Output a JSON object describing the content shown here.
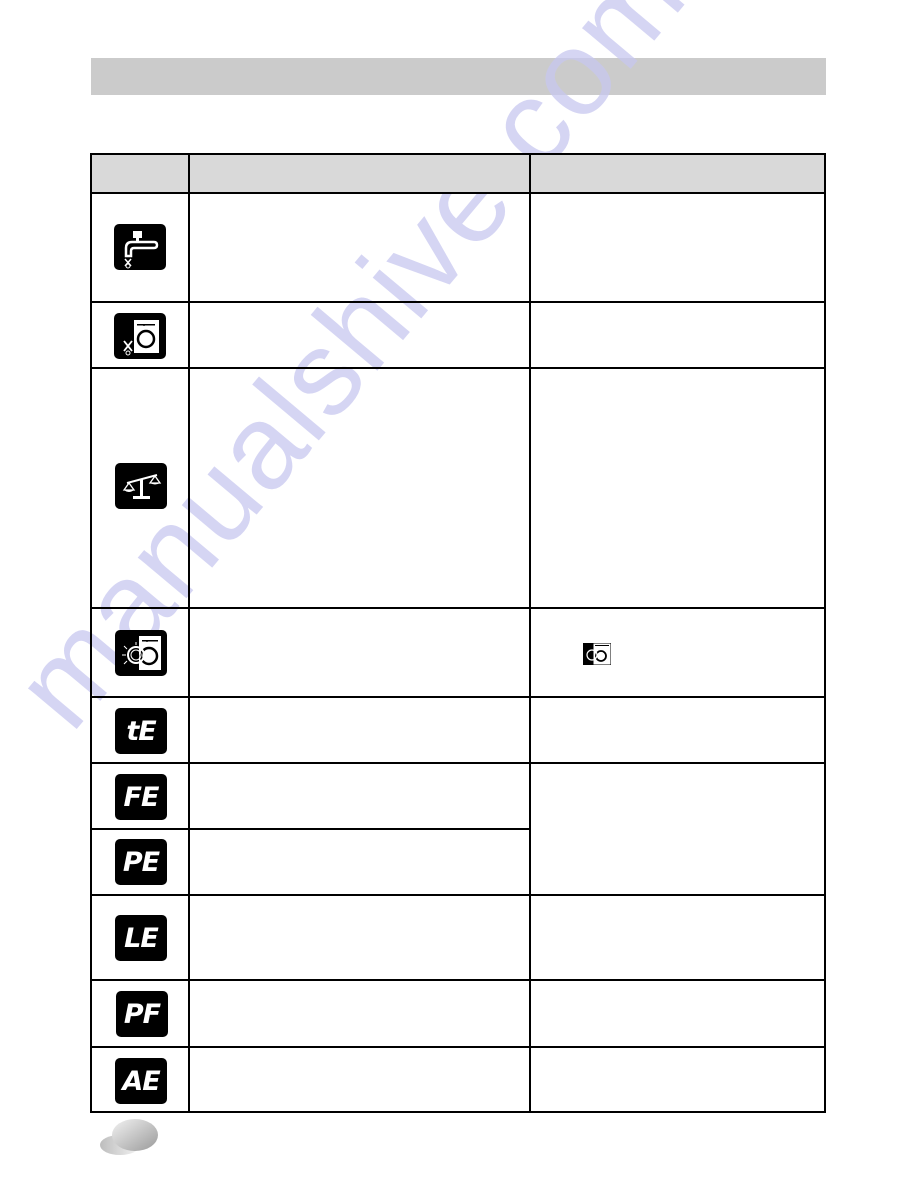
{
  "page": {
    "title_bar_text": "",
    "watermark": "manualshive.com",
    "colors": {
      "title_bar": "#cbcbcb",
      "table_header": "#d9d9d9",
      "border": "#000000",
      "icon_bg": "#000000",
      "icon_fg": "#ffffff",
      "watermark": "#c8c8f0"
    }
  },
  "table": {
    "headers": [
      "",
      "",
      ""
    ],
    "rows": [
      {
        "icon": "water-tap-error-icon",
        "code": "",
        "cause": "",
        "solution": ""
      },
      {
        "icon": "door-open-error-icon",
        "code": "",
        "cause": "",
        "solution": ""
      },
      {
        "icon": "unbalance-scale-icon",
        "code": "",
        "cause": "",
        "solution": ""
      },
      {
        "icon": "door-lock-washer-icon",
        "code": "",
        "cause": "",
        "solution": "",
        "solution_icon": "door-lock-washer-small-icon"
      },
      {
        "icon": "error-code-icon",
        "code": "tE",
        "cause": "",
        "solution": ""
      },
      {
        "icon": "error-code-icon",
        "code": "FE",
        "cause": "",
        "solution": ""
      },
      {
        "icon": "error-code-icon",
        "code": "PE",
        "cause": ""
      },
      {
        "icon": "error-code-icon",
        "code": "LE",
        "cause": "",
        "solution": ""
      },
      {
        "icon": "error-code-icon",
        "code": "PF",
        "cause": "",
        "solution": ""
      },
      {
        "icon": "error-code-icon",
        "code": "AE",
        "cause": "",
        "solution": ""
      }
    ]
  },
  "footer": {
    "page_number": ""
  }
}
